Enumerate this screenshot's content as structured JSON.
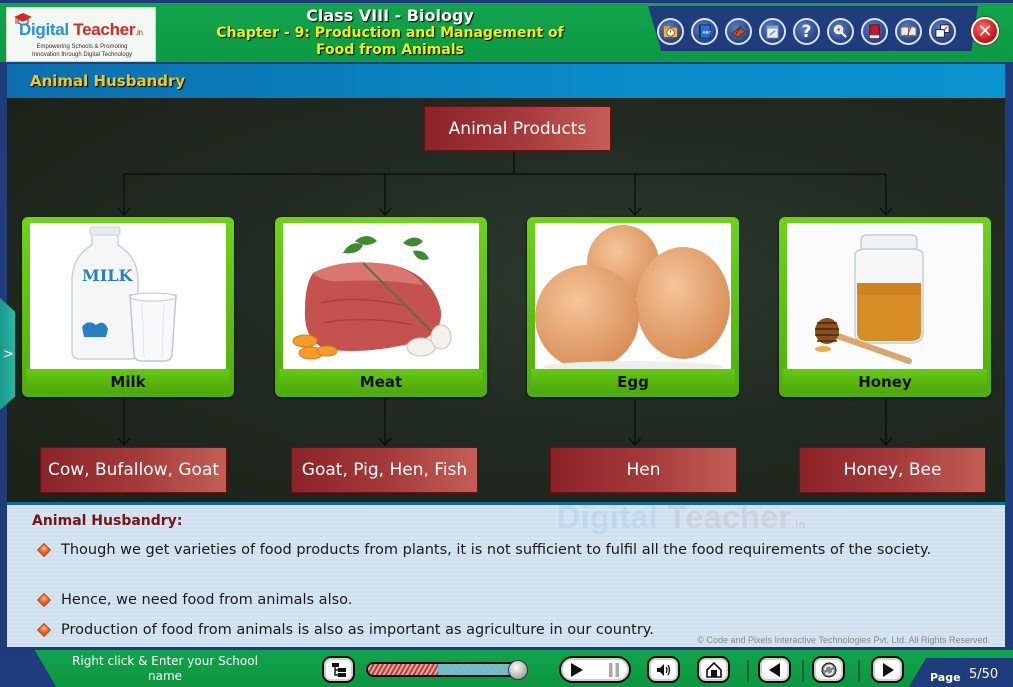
{
  "header": {
    "logo": {
      "brand_part1": "Digital",
      "brand_part2": "Teacher",
      "brand_suffix": ".in",
      "tagline_line1": "Empowering Schools & Promoting",
      "tagline_line2": "Innovation through Digital Technology"
    },
    "class_title": "Class VIII - Biology",
    "chapter_title_line1": "Chapter - 9: Production and Management of",
    "chapter_title_line2": "Food from Animals",
    "toolbar": [
      {
        "icon": "folder-clock-icon",
        "label": "Resources"
      },
      {
        "icon": "notebook-icon",
        "label": "Notes"
      },
      {
        "icon": "drawing-tablet-icon",
        "label": "Whiteboard"
      },
      {
        "icon": "calendar-icon",
        "label": "Planner"
      },
      {
        "icon": "help-icon",
        "label": "Help",
        "glyph": "?"
      },
      {
        "icon": "magnifier-icon",
        "label": "Zoom"
      },
      {
        "icon": "red-book-icon",
        "label": "Dictionary"
      },
      {
        "icon": "open-book-icon",
        "label": "Glossary"
      },
      {
        "icon": "window-restore-icon",
        "label": "Window"
      }
    ],
    "close_glyph": "✕"
  },
  "section": {
    "title": "Animal Husbandry"
  },
  "diagram": {
    "root": "Animal Products",
    "products": [
      {
        "name": "Milk",
        "image": "milk-bottle-and-glass",
        "sources": "Cow, Bufallow, Goat"
      },
      {
        "name": "Meat",
        "image": "raw-meat-with-herbs",
        "sources": "Goat, Pig, Hen, Fish"
      },
      {
        "name": "Egg",
        "image": "three-brown-eggs",
        "sources": "Hen"
      },
      {
        "name": "Honey",
        "image": "honey-jar-with-dipper",
        "sources": "Honey, Bee"
      }
    ]
  },
  "side_tab": {
    "glyph": ">"
  },
  "text_panel": {
    "watermark_part1": "Digital",
    "watermark_part2": "Teacher",
    "watermark_suffix": ".in",
    "heading": "Animal Husbandry:",
    "bullets": [
      "Though we get varieties of food products from plants, it is not sufficient to fulfil all the food requirements of the society.",
      "Hence, we need food from animals also.",
      "Production of food from animals is also as important as agriculture in our country."
    ],
    "copyright": "© Code and Pixels Interactive Technologies  Pvt. Ltd. All Rights Reserved."
  },
  "footer": {
    "school_name": "Right click & Enter your School name",
    "progress_percent": 95,
    "buttons": {
      "index": "index-tree-icon",
      "play_pause": "play-pause-icon",
      "volume": "speaker-icon",
      "home": "home-icon",
      "previous": "previous-icon",
      "replay": "replay-icon",
      "next": "next-icon"
    },
    "page_label": "Page",
    "page_count": "5/50"
  }
}
